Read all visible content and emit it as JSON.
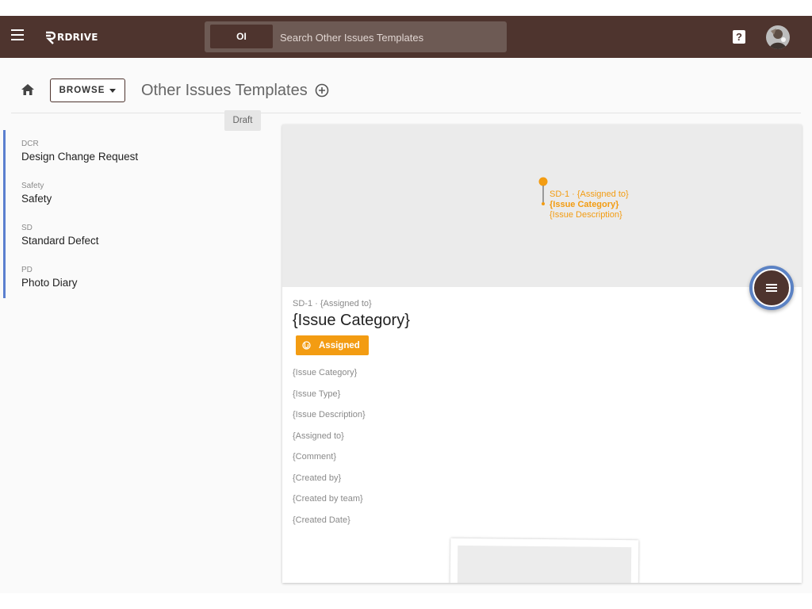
{
  "app": {
    "logo_text": "RDRIVE"
  },
  "search": {
    "prefix": "OI",
    "placeholder": "Search Other Issues Templates"
  },
  "header": {
    "help_label": "?"
  },
  "breadcrumb": {
    "browse_label": "BROWSE",
    "title": "Other Issues Templates"
  },
  "templates": [
    {
      "code": "DCR",
      "name": "Design Change Request"
    },
    {
      "code": "Safety",
      "name": "Safety"
    },
    {
      "code": "SD",
      "name": "Standard Defect",
      "badge": "Draft"
    },
    {
      "code": "PD",
      "name": "Photo Diary"
    }
  ],
  "map_pin": {
    "line1": "SD-1 · {Assigned to}",
    "line2": "{Issue Category}",
    "line3": "{Issue Description}"
  },
  "detail": {
    "subtitle": "SD-1 · {Assigned to}",
    "title": "{Issue Category}",
    "status": "Assigned",
    "fields": [
      "{Issue Category}",
      "{Issue Type}",
      "{Issue Description}",
      "{Assigned to}",
      "{Comment}",
      "{Created by}",
      "{Created by team}",
      "{Created Date}"
    ]
  },
  "colors": {
    "topbar": "#4e342e",
    "accent": "#f39c12",
    "list_indicator": "#5b7fcf"
  }
}
